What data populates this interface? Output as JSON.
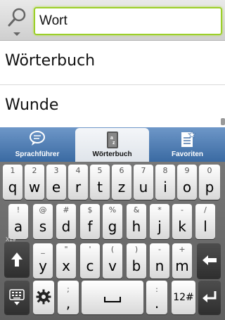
{
  "search": {
    "value": "Wort"
  },
  "results": [
    "Wörterbuch",
    "Wunde"
  ],
  "tabs": [
    {
      "label": "Sprachführer",
      "icon": "speech-bubble-icon"
    },
    {
      "label": "Wörterbuch",
      "icon": "dictionary-book-icon",
      "selected": true
    },
    {
      "label": "Favoriten",
      "icon": "favorites-list-icon"
    }
  ],
  "keyboard": {
    "row1": [
      {
        "main": "q",
        "hint": "1"
      },
      {
        "main": "w",
        "hint": "2"
      },
      {
        "main": "e",
        "hint": "3"
      },
      {
        "main": "r",
        "hint": "4"
      },
      {
        "main": "t",
        "hint": "5"
      },
      {
        "main": "z",
        "hint": "6"
      },
      {
        "main": "u",
        "hint": "7"
      },
      {
        "main": "i",
        "hint": "8"
      },
      {
        "main": "o",
        "hint": "9"
      },
      {
        "main": "p",
        "hint": "0"
      }
    ],
    "row2": [
      {
        "main": "a",
        "hint": "!"
      },
      {
        "main": "s",
        "hint": "@"
      },
      {
        "main": "d",
        "hint": "#"
      },
      {
        "main": "f",
        "hint": "$"
      },
      {
        "main": "g",
        "hint": "%"
      },
      {
        "main": "h",
        "hint": "&"
      },
      {
        "main": "j",
        "hint": "*"
      },
      {
        "main": "k",
        "hint": "-"
      },
      {
        "main": "l",
        "hint": "/"
      }
    ],
    "row3": [
      {
        "main": "y",
        "hint": "_"
      },
      {
        "main": "x",
        "hint": "\""
      },
      {
        "main": "c",
        "hint": "'"
      },
      {
        "main": "v",
        "hint": "("
      },
      {
        "main": "b",
        "hint": ")"
      },
      {
        "main": "n",
        "hint": "-"
      },
      {
        "main": "m",
        "hint": "+"
      }
    ],
    "label_x19": "X19",
    "comma": {
      "main": ",",
      "hint": ";"
    },
    "period": {
      "main": ".",
      "hint": ":"
    },
    "symbols_label": "12#"
  }
}
